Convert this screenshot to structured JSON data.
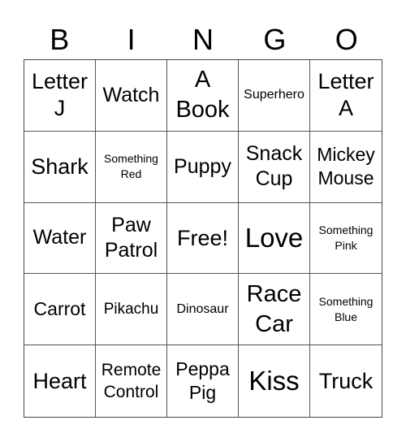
{
  "header": [
    "B",
    "I",
    "N",
    "G",
    "O"
  ],
  "cells": [
    {
      "text": "Letter J",
      "size": "s27"
    },
    {
      "text": "Watch",
      "size": "s25"
    },
    {
      "text": "A Book",
      "size": "s29"
    },
    {
      "text": "Superhero",
      "size": "s15"
    },
    {
      "text": "Letter A",
      "size": "s27"
    },
    {
      "text": "Shark",
      "size": "s27"
    },
    {
      "text": "Something Red",
      "size": "s13"
    },
    {
      "text": "Puppy",
      "size": "s25"
    },
    {
      "text": "Snack Cup",
      "size": "s25"
    },
    {
      "text": "Mickey Mouse",
      "size": "s23"
    },
    {
      "text": "Water",
      "size": "s25"
    },
    {
      "text": "Paw Patrol",
      "size": "s25"
    },
    {
      "text": "Free!",
      "size": "s27"
    },
    {
      "text": "Love",
      "size": "s33"
    },
    {
      "text": "Something Pink",
      "size": "s13"
    },
    {
      "text": "Carrot",
      "size": "s23"
    },
    {
      "text": "Pikachu",
      "size": "s18"
    },
    {
      "text": "Dinosaur",
      "size": "s15"
    },
    {
      "text": "Race Car",
      "size": "s29"
    },
    {
      "text": "Something Blue",
      "size": "s13"
    },
    {
      "text": "Heart",
      "size": "s27"
    },
    {
      "text": "Remote Control",
      "size": "s20"
    },
    {
      "text": "Peppa Pig",
      "size": "s23"
    },
    {
      "text": "Kiss",
      "size": "s33"
    },
    {
      "text": "Truck",
      "size": "s27"
    }
  ]
}
